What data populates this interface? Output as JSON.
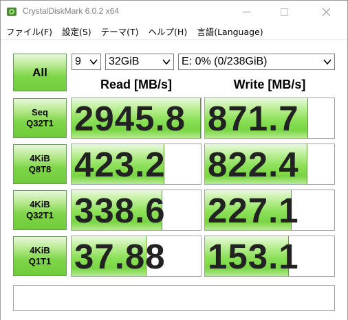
{
  "window": {
    "title": "CrystalDiskMark 6.0.2 x64"
  },
  "menu": [
    "ファイル(F)",
    "設定(S)",
    "テーマ(T)",
    "ヘルプ(H)",
    "言語(Language)"
  ],
  "controls": {
    "all_label": "All",
    "count": "9",
    "size": "32GiB",
    "drive": "E: 0% (0/238GiB)"
  },
  "headers": {
    "read": "Read [MB/s]",
    "write": "Write [MB/s]"
  },
  "rows": [
    {
      "line1": "Seq",
      "line2": "Q32T1",
      "read": "2945.8",
      "write": "871.7",
      "read_fraction": 1.0,
      "write_fraction": 0.8
    },
    {
      "line1": "4KiB",
      "line2": "Q8T8",
      "read": "423.2",
      "write": "822.4",
      "read_fraction": 0.72,
      "write_fraction": 0.79
    },
    {
      "line1": "4KiB",
      "line2": "Q32T1",
      "read": "338.6",
      "write": "227.1",
      "read_fraction": 0.7,
      "write_fraction": 0.67
    },
    {
      "line1": "4KiB",
      "line2": "Q1T1",
      "read": "37.88",
      "write": "153.1",
      "read_fraction": 0.58,
      "write_fraction": 0.65
    }
  ],
  "comment": "",
  "colors": {
    "accent_green": "#7fd64a",
    "fill_border": "#5aa030"
  }
}
